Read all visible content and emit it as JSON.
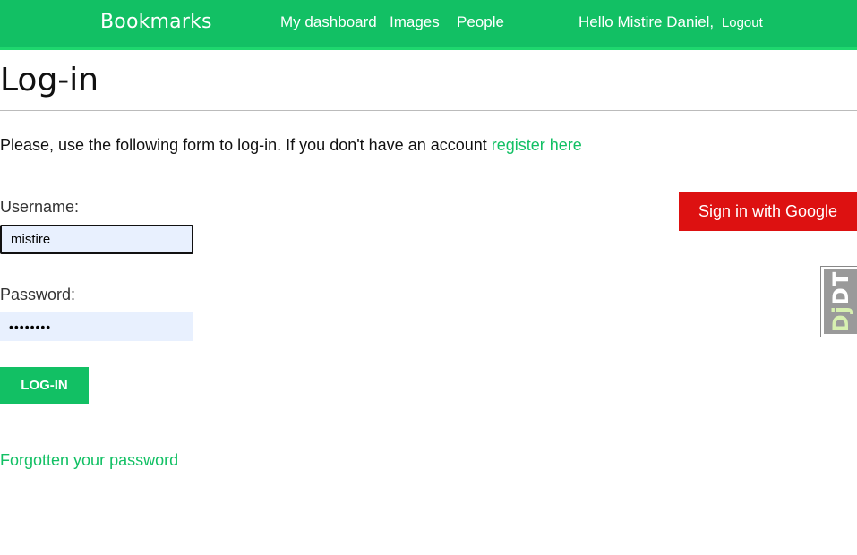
{
  "header": {
    "brand": "Bookmarks",
    "nav": [
      {
        "label": "My dashboard"
      },
      {
        "label": "Images"
      },
      {
        "label": "People"
      }
    ],
    "greeting": "Hello Mistire Daniel,",
    "logout_label": "Logout"
  },
  "page": {
    "title": "Log-in",
    "intro_text": "Please, use the following form to log-in. If you don't have an account ",
    "register_link": "register here"
  },
  "form": {
    "username_label": "Username:",
    "username_value": "mistire",
    "password_label": "Password:",
    "password_value": "mistire1",
    "submit_label": "Log-in",
    "forgot_link": "Forgotten your password"
  },
  "social": {
    "google_label": "Sign in with Google"
  },
  "debug_toolbar": {
    "prefix": "Dj",
    "suffix": "DT"
  },
  "colors": {
    "accent": "#12c064",
    "google": "#dd1111",
    "input_bg": "#e8f0fe"
  }
}
